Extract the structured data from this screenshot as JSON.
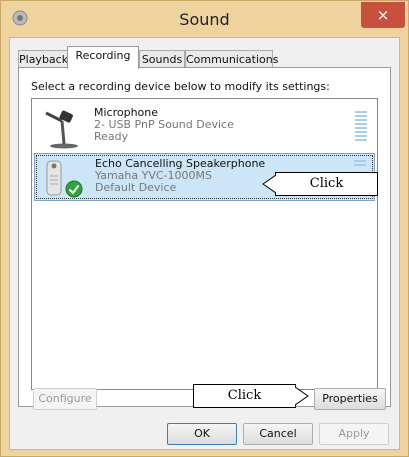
{
  "window": {
    "title": "Sound",
    "close": "×"
  },
  "tabs": [
    {
      "label": "Playback",
      "active": false
    },
    {
      "label": "Recording",
      "active": true
    },
    {
      "label": "Sounds",
      "active": false
    },
    {
      "label": "Communications",
      "active": false
    }
  ],
  "panel": {
    "instruction": "Select a recording device below to modify its settings:",
    "devices": [
      {
        "name": "Microphone",
        "detail": "2- USB PnP Sound Device",
        "status": "Ready",
        "selected": false,
        "icon": "microphone-icon"
      },
      {
        "name": "Echo Cancelling Speakerphone",
        "detail": "Yamaha YVC-1000MS",
        "status": "Default Device",
        "selected": true,
        "icon": "speakerphone-icon",
        "badge": "default-checkmark-icon"
      }
    ]
  },
  "buttons": {
    "configure": "Configure",
    "properties": "Properties",
    "ok": "OK",
    "cancel": "Cancel",
    "apply": "Apply"
  },
  "callouts": {
    "device": "Click",
    "properties": "Click"
  },
  "colors": {
    "selection": "#cde6f7",
    "frame": "#eed39f",
    "close": "#c7503f",
    "check": "#2fa33f"
  }
}
